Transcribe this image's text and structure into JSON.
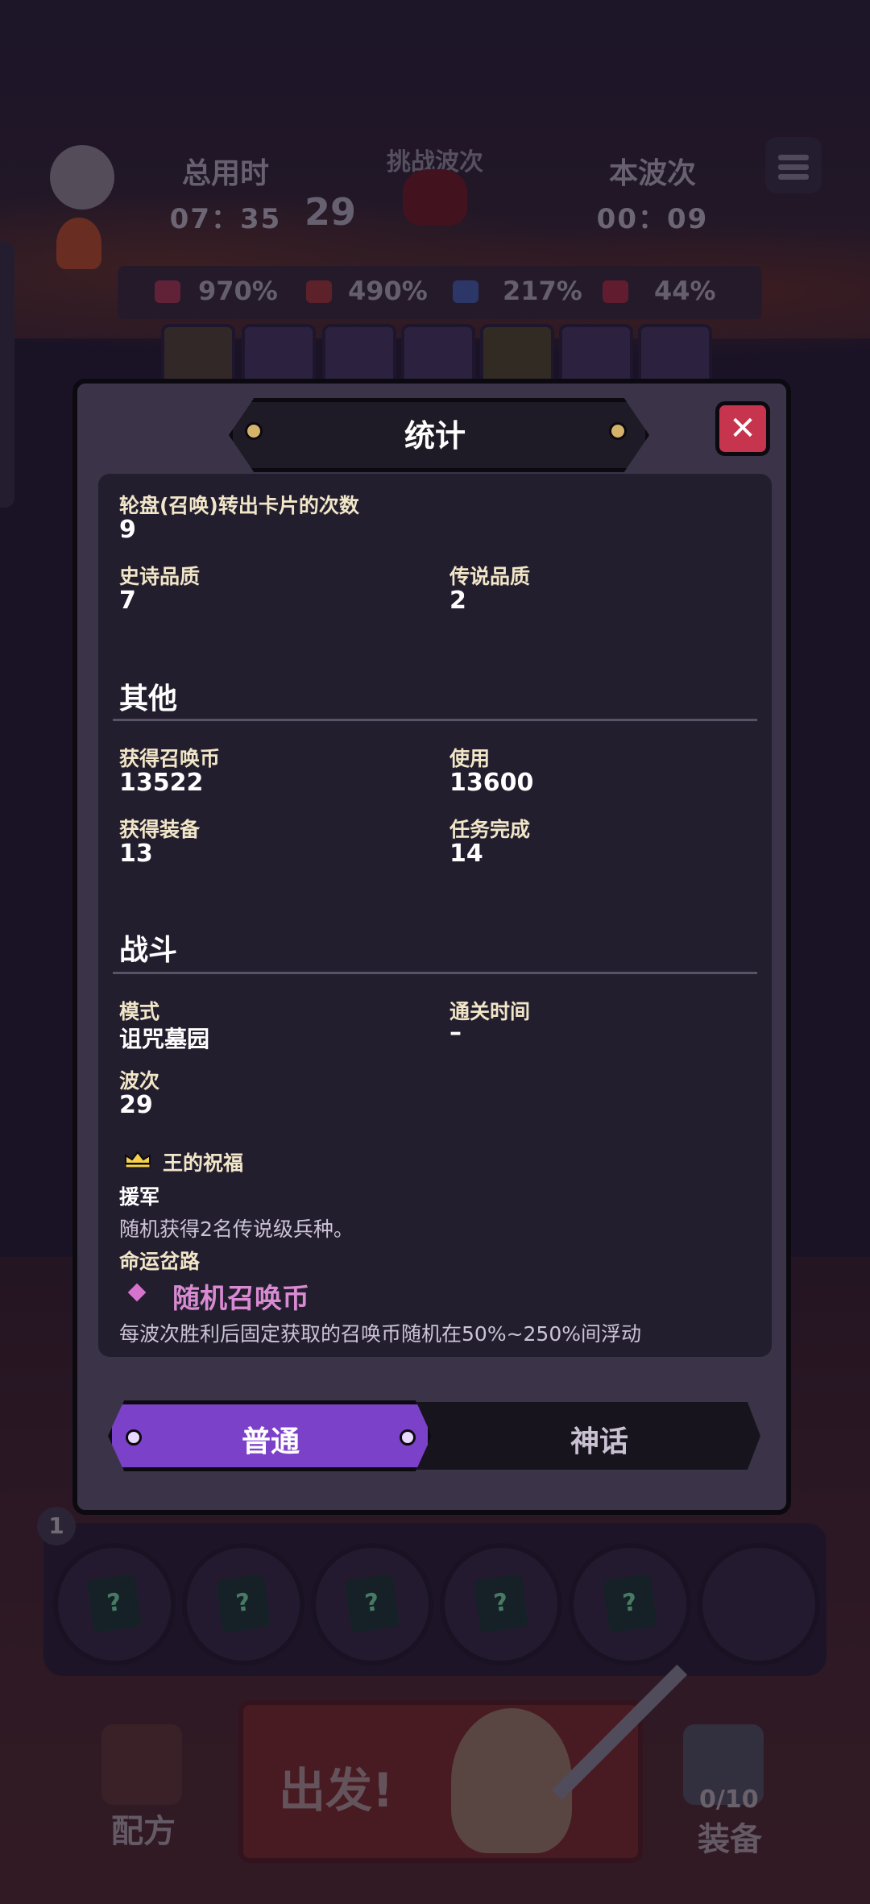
{
  "hud": {
    "total_time_label": "总用时",
    "total_time_value": "07：35",
    "challenge_wave_label": "挑战波次",
    "challenge_wave_value": "29",
    "current_wave_label": "本波次",
    "current_wave_value": "00：09",
    "percents": [
      "970%",
      "490%",
      "217%",
      "44%"
    ]
  },
  "modal": {
    "title": "统计",
    "close_symbol": "✕",
    "summon_turns_label": "轮盘(召唤)转出卡片的次数",
    "summon_turns_value": "9",
    "epic_label": "史诗品质",
    "epic_value": "7",
    "legend_label": "传说品质",
    "legend_value": "2",
    "other_section": "其他",
    "coins_got_label": "获得召唤币",
    "coins_got_value": "13522",
    "coins_used_label": "使用",
    "coins_used_value": "13600",
    "equip_label": "获得装备",
    "equip_value": "13",
    "quest_label": "任务完成",
    "quest_value": "14",
    "battle_section": "战斗",
    "mode_label": "模式",
    "mode_value": "诅咒墓园",
    "clear_time_label": "通关时间",
    "clear_time_value": "–",
    "wave_label": "波次",
    "wave_value": "29",
    "blessing_label": "王的祝福",
    "blessing_name": "援军",
    "blessing_desc": "随机获得2名传说级兵种。",
    "fate_label": "命运岔路",
    "fate_name": "随机召唤币",
    "fate_desc": "每波次胜利后固定获取的召唤币随机在50%~250%间浮动",
    "tabs": [
      "普通",
      "神话"
    ],
    "active_tab": "普通"
  },
  "bottom": {
    "slot_count": "1",
    "go_label": "出发!",
    "recipe_label": "配方",
    "equip_label": "装备",
    "equip_count": "0/10"
  },
  "colors": {
    "accent_purple": "#7b42c9",
    "close_red": "#c6344e",
    "label_cream": "#f1e6c8",
    "fate_pink": "#d88ad2"
  }
}
